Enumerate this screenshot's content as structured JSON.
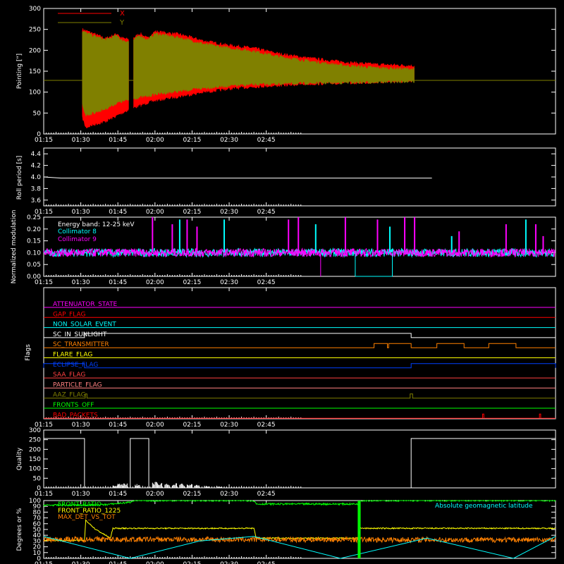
{
  "time_ticks": [
    "01:15",
    "01:30",
    "01:45",
    "02:00",
    "02:15",
    "02:30",
    "02:45"
  ],
  "chart_data": [
    {
      "id": "pointing",
      "type": "area",
      "ylabel": "Pointing [\"]",
      "ylim": [
        0,
        300
      ],
      "yticks": [
        0,
        50,
        100,
        150,
        200,
        250,
        300
      ],
      "legend": [
        {
          "name": "X",
          "color": "#ff0000"
        },
        {
          "name": "Y",
          "color": "#808000"
        }
      ],
      "legend_position": "top-left",
      "series": [
        {
          "name": "X",
          "color": "#ff0000",
          "upper": [
            [
              90.6,
              250
            ],
            [
              95,
              240
            ],
            [
              100,
              228
            ],
            [
              105,
              240
            ],
            [
              106,
              230
            ],
            [
              110,
              225
            ],
            [
              114,
              240
            ],
            [
              117,
              228
            ],
            [
              120,
              245
            ],
            [
              130,
              238
            ],
            [
              140,
              222
            ],
            [
              150,
              212
            ],
            [
              160,
              205
            ],
            [
              170,
              192
            ],
            [
              180,
              183
            ],
            [
              190,
              176
            ],
            [
              200,
              170
            ],
            [
              210,
              166
            ],
            [
              220,
              164
            ],
            [
              225,
              163
            ]
          ],
          "lower": [
            [
              90.6,
              40
            ],
            [
              92,
              15
            ],
            [
              95,
              22
            ],
            [
              100,
              30
            ],
            [
              105,
              45
            ],
            [
              110,
              60
            ],
            [
              114,
              68
            ],
            [
              117,
              75
            ],
            [
              120,
              80
            ],
            [
              130,
              90
            ],
            [
              140,
              100
            ],
            [
              150,
              108
            ],
            [
              160,
              113
            ],
            [
              170,
              116
            ],
            [
              180,
              119
            ],
            [
              190,
              121
            ],
            [
              200,
              122
            ],
            [
              210,
              124
            ],
            [
              220,
              125
            ],
            [
              225,
              126
            ]
          ]
        },
        {
          "name": "Y",
          "color": "#808000",
          "upper": [
            [
              90.6,
              245
            ],
            [
              95,
              235
            ],
            [
              100,
              225
            ],
            [
              105,
              236
            ],
            [
              106,
              225
            ],
            [
              110,
              220
            ],
            [
              114,
              235
            ],
            [
              117,
              225
            ],
            [
              120,
              240
            ],
            [
              130,
              230
            ],
            [
              140,
              215
            ],
            [
              150,
              205
            ],
            [
              160,
              198
            ],
            [
              170,
              185
            ],
            [
              180,
              176
            ],
            [
              190,
              168
            ],
            [
              200,
              162
            ],
            [
              210,
              158
            ],
            [
              220,
              156
            ],
            [
              225,
              155
            ]
          ],
          "lower": [
            [
              90.6,
              70
            ],
            [
              92,
              45
            ],
            [
              95,
              50
            ],
            [
              100,
              60
            ],
            [
              105,
              75
            ],
            [
              110,
              82
            ],
            [
              114,
              88
            ],
            [
              117,
              90
            ],
            [
              120,
              95
            ],
            [
              130,
              102
            ],
            [
              140,
              110
            ],
            [
              150,
              115
            ],
            [
              160,
              118
            ],
            [
              170,
              120
            ],
            [
              180,
              121
            ],
            [
              190,
              122
            ],
            [
              200,
              123
            ],
            [
              210,
              124
            ],
            [
              220,
              125
            ],
            [
              225,
              126
            ]
          ]
        }
      ],
      "gaps": [
        [
          109.5,
          111.2
        ]
      ],
      "baseline": 128
    },
    {
      "id": "roll",
      "type": "line",
      "ylabel": "Roll period [s]",
      "ylim": [
        3.5,
        4.5
      ],
      "yticks": [
        3.6,
        3.8,
        4.0,
        4.2,
        4.4
      ],
      "series": [
        {
          "color": "#ffffff",
          "points": [
            [
              75,
              4.0
            ],
            [
              82,
              3.98
            ],
            [
              85,
              3.98
            ],
            [
              160,
              3.98
            ],
            [
              232,
              3.98
            ]
          ]
        }
      ]
    },
    {
      "id": "modulation",
      "type": "line",
      "ylabel": "Normalized modulation",
      "ylim": [
        0,
        0.25
      ],
      "yticks": [
        0.0,
        0.05,
        0.1,
        0.15,
        0.2,
        0.25
      ],
      "annotations": [
        "Energy band: 12-25 keV"
      ],
      "legend": [
        {
          "name": "Collimator 8",
          "color": "#00ffff"
        },
        {
          "name": "Collimator 9",
          "color": "#ff00ff"
        }
      ],
      "baseline": 0.1,
      "spikes": [
        [
          119,
          0.25
        ],
        [
          127,
          0.22
        ],
        [
          130,
          0.24
        ],
        [
          133,
          0.24
        ],
        [
          137,
          0.21
        ],
        [
          148,
          0.24
        ],
        [
          174,
          0.24
        ],
        [
          178,
          0.25
        ],
        [
          185,
          0.22
        ],
        [
          197,
          0.25
        ],
        [
          210,
          0.24
        ],
        [
          215,
          0.21
        ],
        [
          221,
          0.25
        ],
        [
          225,
          0.25
        ],
        [
          240,
          0.17
        ],
        [
          243,
          0.19
        ],
        [
          262,
          0.22
        ],
        [
          270,
          0.24
        ],
        [
          274,
          0.22
        ],
        [
          277,
          0.17
        ]
      ],
      "dips": [
        [
          187,
          0.0
        ],
        [
          201,
          0.0
        ],
        [
          216,
          0.0
        ]
      ]
    },
    {
      "id": "flags",
      "type": "line",
      "ylabel": "Flags",
      "flags": [
        {
          "name": "ATTENUATOR_STATE",
          "color": "#ff00ff",
          "segments": []
        },
        {
          "name": "GAP_FLAG",
          "color": "#ff0000",
          "segments": []
        },
        {
          "name": "NON_SOLAR_EVENT",
          "color": "#00ffff",
          "segments": []
        },
        {
          "name": "SC_IN_SUNLIGHT",
          "color": "#ffffff",
          "segments": [
            [
              91.5,
              223.6
            ]
          ]
        },
        {
          "name": "SC_TRANSMITTER",
          "color": "#ff8000",
          "segments": [
            [
              208.6,
              214
            ],
            [
              214.5,
              223.6
            ],
            [
              234,
              245
            ],
            [
              255,
              266
            ]
          ]
        },
        {
          "name": "FLARE_FLAG",
          "color": "#ffff00",
          "segments": []
        },
        {
          "name": "ECLIPSE_FLAG",
          "color": "#0040ff",
          "segments": [
            [
              75,
              91.5
            ],
            [
              223.6,
              282
            ]
          ]
        },
        {
          "name": "SAA_FLAG",
          "color": "#ff4040",
          "segments": []
        },
        {
          "name": "PARTICLE_FLAG",
          "color": "#ff8080",
          "segments": []
        },
        {
          "name": "AAZ_FLAG",
          "color": "#808000",
          "segments": [
            [
              91.8,
              92.5
            ],
            [
              223.2,
              224.2
            ]
          ]
        },
        {
          "name": "FRONTS_OFF",
          "color": "#00ff00",
          "segments": []
        },
        {
          "name": "BAD_PACKETS",
          "color": "#ff0000",
          "segments": [
            [
              252.5,
              253
            ],
            [
              275.5,
              276
            ]
          ]
        }
      ]
    },
    {
      "id": "quality",
      "type": "line",
      "ylabel": "Quality",
      "ylim": [
        0,
        300
      ],
      "yticks": [
        0,
        50,
        100,
        150,
        200,
        250,
        300
      ],
      "series": [
        {
          "color": "#ffffff",
          "points": [
            [
              75,
              256
            ],
            [
              91.5,
              256
            ],
            [
              91.5,
              0
            ],
            [
              110,
              0
            ],
            [
              110,
              256
            ],
            [
              117.5,
              256
            ],
            [
              117.5,
              0
            ],
            [
              223.6,
              0
            ],
            [
              223.6,
              256
            ],
            [
              282,
              256
            ]
          ]
        }
      ],
      "bursts": [
        [
          103,
          15
        ],
        [
          105,
          20
        ],
        [
          107,
          22
        ],
        [
          112,
          18
        ],
        [
          119,
          30
        ],
        [
          121,
          26
        ],
        [
          124,
          24
        ],
        [
          127,
          22
        ],
        [
          130,
          20
        ],
        [
          133,
          18
        ],
        [
          136,
          15
        ],
        [
          140,
          10
        ],
        [
          145,
          6
        ]
      ]
    },
    {
      "id": "misc",
      "type": "line",
      "ylabel": "Degrees or %",
      "ylim": [
        0,
        100
      ],
      "yticks": [
        0,
        10,
        20,
        30,
        40,
        50,
        60,
        70,
        80,
        90,
        100
      ],
      "legend": [
        {
          "name": "FRONT_RATIO",
          "color": "#00ff00"
        },
        {
          "name": "FRONT_RATIO_1225",
          "color": "#ffff00"
        },
        {
          "name": "MAX_DET_VS_TOT",
          "color": "#ff8000"
        }
      ],
      "annotations": [
        "Absolute geomagnetic latitude"
      ],
      "series": [
        {
          "name": "FRONT_RATIO",
          "color": "#00ff00",
          "points": [
            [
              75,
              92
            ],
            [
              91.5,
              92
            ],
            [
              100,
              93
            ],
            [
              110,
              97
            ],
            [
              111,
              100
            ],
            [
              160,
              100
            ],
            [
              161,
              94
            ],
            [
              202,
              94
            ],
            [
              203,
              100
            ],
            [
              282,
              100
            ]
          ]
        },
        {
          "name": "FRONT_RATIO_1225",
          "color": "#ffff00",
          "points": [
            [
              75,
              31
            ],
            [
              91.5,
              31
            ],
            [
              92,
              66
            ],
            [
              96,
              50
            ],
            [
              102,
              35
            ],
            [
              103,
              52
            ],
            [
              160,
              52
            ],
            [
              161,
              35
            ],
            [
              202,
              35
            ],
            [
              203,
              52
            ],
            [
              282,
              52
            ]
          ]
        },
        {
          "name": "MAX_DET_VS_TOT",
          "color": "#ff8000",
          "points": [
            [
              75,
              33
            ],
            [
              282,
              32
            ]
          ]
        },
        {
          "name": "Absolute geomagnetic latitude",
          "color": "#00ffff",
          "points": [
            [
              75,
              38
            ],
            [
              110,
              0
            ],
            [
              138,
              30
            ],
            [
              160,
              38
            ],
            [
              195,
              0
            ],
            [
              230,
              35
            ],
            [
              265,
              0
            ],
            [
              282,
              38
            ]
          ]
        }
      ]
    }
  ]
}
